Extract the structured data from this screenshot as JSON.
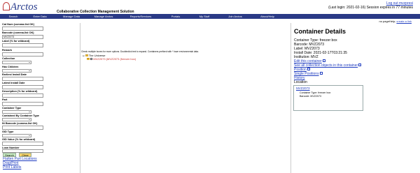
{
  "header": {
    "logo": "Arctos",
    "app_title": "Collaborative Collection Management Solution",
    "logout_link": "Log out mvzpresi",
    "session_text": "(Last login: 2021-02-16) Session expires in 77 minutes"
  },
  "nav": [
    "Search",
    "Enter Data",
    "Manage Data",
    "Manage Arctos",
    "Reports/Services",
    "Portals",
    "My Stuff",
    "Join Arctos",
    "About/Help"
  ],
  "pageinfo": {
    "text": "no pageHelp",
    "link": "create a link"
  },
  "search_form": {
    "fields": [
      {
        "label": "Cat Num (comma-list OK)",
        "type": "input",
        "value": ""
      },
      {
        "label": "Barcode (comma-list OK)",
        "type": "input",
        "value": "MVZ2073"
      },
      {
        "label": "Label (% for wildcard)",
        "type": "input",
        "value": ""
      },
      {
        "label": "Remark",
        "type": "input",
        "value": ""
      },
      {
        "label": "Collection",
        "type": "select",
        "value": ""
      },
      {
        "label": "Has Children",
        "type": "select",
        "value": ""
      },
      {
        "label": "Earliest Install Date",
        "type": "input",
        "value": ""
      },
      {
        "label": "Latest Install Date",
        "type": "input",
        "value": ""
      },
      {
        "label": "Description (% for wildcard)",
        "type": "input",
        "value": ""
      },
      {
        "label": "Part",
        "type": "input",
        "value": ""
      },
      {
        "label": "Container Type",
        "type": "select",
        "value": ""
      },
      {
        "label": "Contained By Container Type",
        "type": "select",
        "value": ""
      },
      {
        "label": "IN Barcode (comma-list OK)",
        "type": "input",
        "value": ""
      },
      {
        "label": "GID Type",
        "type": "select",
        "value": ""
      },
      {
        "label": "GID Value (% for wildcard)",
        "type": "input",
        "value": ""
      },
      {
        "label": "Loan Number",
        "type": "input",
        "value": ""
      }
    ],
    "search_button": "Search",
    "clear_button": "Clear",
    "links": [
      "Flatten Part Locations",
      "Drag/Print",
      "Print Labels"
    ]
  },
  "tree": {
    "help_text": "Check multiple boxes for more options. Doubleclick text to expand. Containers prefixed with * have environmental data.",
    "root": "The Universe",
    "node": "MVZ2073 (MVZ2073 (freezer box)"
  },
  "details": {
    "title": "Container Details",
    "lines": [
      "Container Type: freezer box",
      "Barcode: MVZ2073",
      "Label: MVZ2073",
      "Install Date: 2021-02-17T03:21:35",
      "Institution: MVZ"
    ],
    "links": [
      "Edit this container",
      "See all collection objects in this container",
      "Position",
      "Single Positions",
      "History"
    ],
    "location_label": "Location",
    "location_barcode": "MVZ2073",
    "location_type": "Container Type: freezer box",
    "location_sub_barcode": "Barcode: MVZ2073"
  }
}
